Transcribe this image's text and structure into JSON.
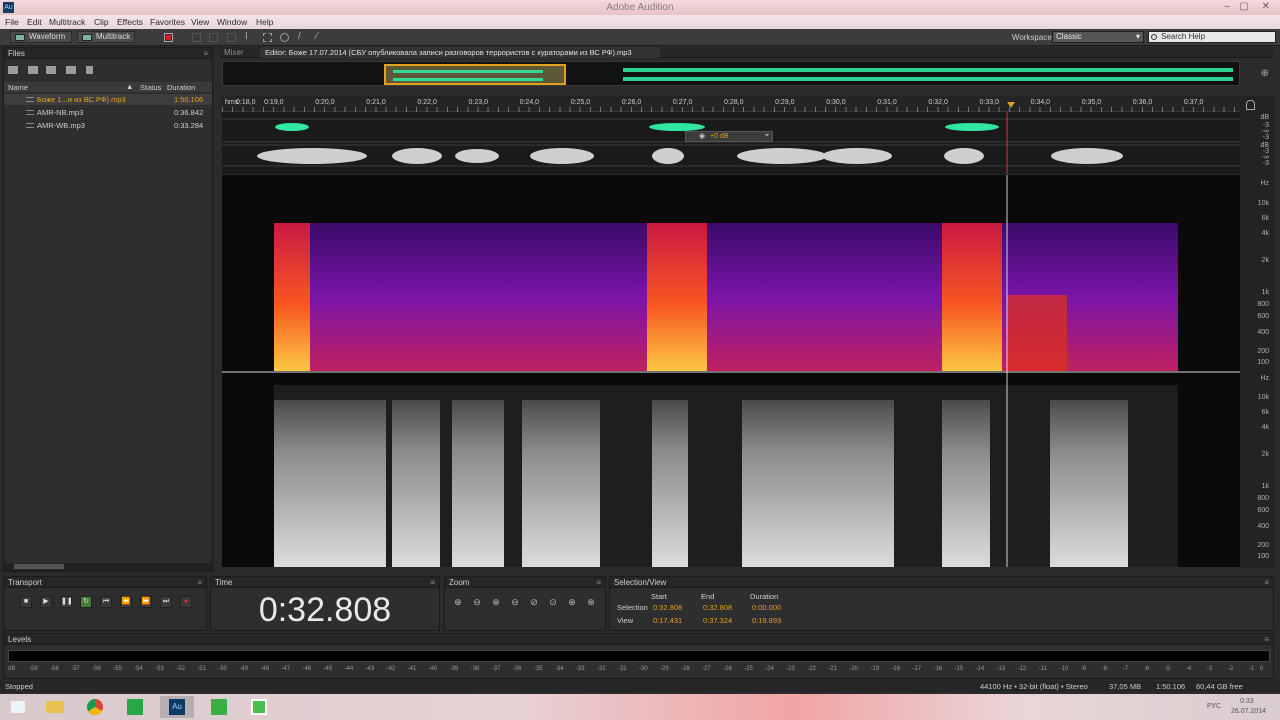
{
  "window": {
    "title": "Adobe Audition",
    "app_icon": "Au"
  },
  "menu": [
    "File",
    "Edit",
    "Multitrack",
    "Clip",
    "Effects",
    "Favorites",
    "View",
    "Window",
    "Help"
  ],
  "toolbar": {
    "waveform_label": "Waveform",
    "multitrack_label": "Multitrack",
    "workspace_label": "Workspace:",
    "workspace_value": "Classic",
    "search_placeholder": "Search Help"
  },
  "files": {
    "tab_label": "Files",
    "columns": {
      "name": "Name",
      "status": "Status",
      "duration": "Duration"
    },
    "rows": [
      {
        "name": "Боже 1...и из ВС РФ).mp3",
        "duration": "1:50.106",
        "selected": true
      },
      {
        "name": "AMR-NB.mp3",
        "duration": "0:36.842",
        "selected": false
      },
      {
        "name": "AMR-WB.mp3",
        "duration": "0:33.284",
        "selected": false
      }
    ]
  },
  "editor": {
    "mixer_tab": "Mixer",
    "editor_tab": "Editor: Боже 17.07.2014 (СБУ опубликовала записи разговоров террористов с кураторами из ВС РФ).mp3",
    "ruler_unit": "hms",
    "ruler_labels": [
      "0:18,0",
      "0:19,0",
      "0:20,0",
      "0:21,0",
      "0:22,0",
      "0:23,0",
      "0:24,0",
      "0:25,0",
      "0:26,0",
      "0:27,0",
      "0:28,0",
      "0:29,0",
      "0:30,0",
      "0:31,0",
      "0:32,0",
      "0:33,0",
      "0:34,0",
      "0:35,0",
      "0:36,0",
      "0:37,0"
    ],
    "hud_gain": "+0 dB",
    "db_labels": [
      "dB",
      "-3",
      "-∞",
      "-3",
      "dB",
      "-3",
      "-∞",
      "-3"
    ],
    "spectral_scale": [
      "Hz",
      "10k",
      "6k",
      "4k",
      "2k",
      "1k",
      "800",
      "600",
      "400",
      "200",
      "100"
    ]
  },
  "transport": {
    "tab_label": "Transport"
  },
  "time": {
    "tab_label": "Time",
    "value": "0:32.808"
  },
  "zoom": {
    "tab_label": "Zoom"
  },
  "selection_view": {
    "tab_label": "Selection/View",
    "headers": {
      "start": "Start",
      "end": "End",
      "duration": "Duration"
    },
    "selection": {
      "label": "Selection",
      "start": "0:32.808",
      "end": "0:32.808",
      "duration": "0:00.000"
    },
    "view": {
      "label": "View",
      "start": "0:17.431",
      "end": "0:37.324",
      "duration": "0:19.893"
    }
  },
  "levels": {
    "tab_label": "Levels",
    "ticks": [
      "dB",
      "-59",
      "-58",
      "-57",
      "-56",
      "-55",
      "-54",
      "-53",
      "-52",
      "-51",
      "-50",
      "-49",
      "-48",
      "-47",
      "-46",
      "-45",
      "-44",
      "-43",
      "-42",
      "-41",
      "-40",
      "-39",
      "-38",
      "-37",
      "-36",
      "-35",
      "-34",
      "-33",
      "-32",
      "-31",
      "-30",
      "-29",
      "-28",
      "-27",
      "-26",
      "-25",
      "-24",
      "-23",
      "-22",
      "-21",
      "-20",
      "-19",
      "-18",
      "-17",
      "-16",
      "-15",
      "-14",
      "-13",
      "-12",
      "-11",
      "-10",
      "-9",
      "-8",
      "-7",
      "-6",
      "-5",
      "-4",
      "-3",
      "-2",
      "-1",
      "0"
    ]
  },
  "status": {
    "state": "Stopped",
    "format": "44100 Hz • 32-bit (float) • Stereo",
    "size": "37,05 MB",
    "duration": "1:50.106",
    "free": "60,44 GB free"
  },
  "taskbar": {
    "lang": "РУС",
    "clock_time": "0:33",
    "clock_date": "26.07.2014"
  },
  "colors": {
    "accent_waveform": "#31e6a0",
    "spectral_hot": "#ffcc33",
    "time_value": "#e0a020"
  }
}
